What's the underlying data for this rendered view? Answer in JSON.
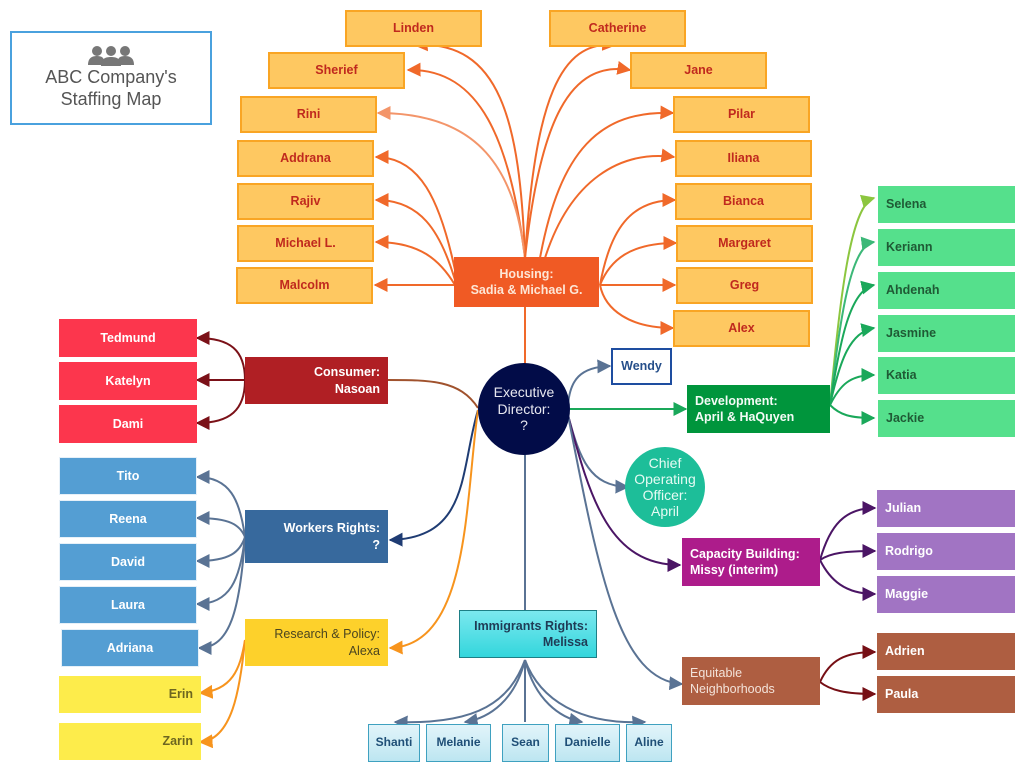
{
  "title": {
    "icon": "people-group-icon",
    "line1": "ABC Company's",
    "line2": "Staffing Map"
  },
  "colors": {
    "housing_hub": "#f05a24",
    "housing_leaf": "#fec861",
    "housing_text": "#c0291e",
    "executive": "#020c48",
    "consumer_hub": "#b01f24",
    "consumer_leaf": "#fc364d",
    "workers_hub": "#37699d",
    "workers_leaf": "#549ed3",
    "research_hub": "#fdd12b",
    "research_leaf": "#fdec4b",
    "immigrants_hub": "#33d6dc",
    "development_hub": "#00953c",
    "development_leaf": "#55e08c",
    "coo": "#1dbe99",
    "capacity_hub": "#ad1c8b",
    "capacity_leaf": "#a174c3",
    "equitable_hub": "#ae5e41",
    "wendy_border": "#1e4da0"
  },
  "executive": {
    "line1": "Executive",
    "line2": "Director:",
    "line3": "?"
  },
  "housing": {
    "label_line1": "Housing:",
    "label_line2": "Sadia & Michael G.",
    "left_staff": [
      "Linden",
      "Sherief",
      "Rini",
      "Addrana",
      "Rajiv",
      "Michael L.",
      "Malcolm"
    ],
    "right_staff": [
      "Catherine",
      "Jane",
      "Pilar",
      "Iliana",
      "Bianca",
      "Margaret",
      "Greg",
      "Alex"
    ]
  },
  "consumer": {
    "label_line1": "Consumer:",
    "label_line2": "Nasoan",
    "staff": [
      "Tedmund",
      "Katelyn",
      "Dami"
    ]
  },
  "workers": {
    "label_line1": "Workers Rights:",
    "label_line2": "?",
    "staff": [
      "Tito",
      "Reena",
      "David",
      "Laura",
      "Adriana"
    ]
  },
  "research": {
    "label_line1": "Research & Policy:",
    "label_line2": "Alexa",
    "staff": [
      "Erin",
      "Zarin"
    ]
  },
  "immigrants": {
    "label_line1": "Immigrants Rights:",
    "label_line2": "Melissa",
    "staff": [
      "Shanti",
      "Melanie",
      "Sean",
      "Danielle",
      "Aline"
    ]
  },
  "wendy": "Wendy",
  "development": {
    "label_line1": "Development:",
    "label_line2": "April & HaQuyen",
    "staff": [
      "Selena",
      "Keriann",
      "Ahdenah",
      "Jasmine",
      "Katia",
      "Jackie"
    ]
  },
  "coo": {
    "line1": "Chief",
    "line2": "Operating",
    "line3": "Officer:",
    "line4": "April"
  },
  "capacity": {
    "label_line1": "Capacity Building:",
    "label_line2": "Missy (interim)",
    "staff": [
      "Julian",
      "Rodrigo",
      "Maggie"
    ]
  },
  "equitable": {
    "label_line1": "Equitable",
    "label_line2": "Neighborhoods",
    "staff": [
      "Adrien",
      "Paula"
    ]
  }
}
